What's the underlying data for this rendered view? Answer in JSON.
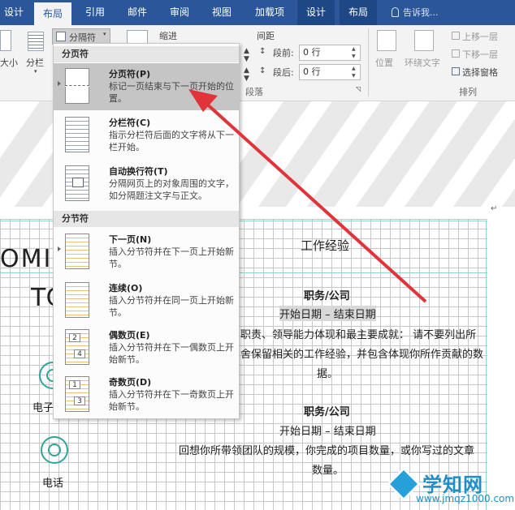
{
  "ribbon_tabs": {
    "design": "设计",
    "layout": "布局",
    "references": "引用",
    "mailings": "邮件",
    "review": "审阅",
    "view": "视图",
    "addins": "加载项",
    "design2": "设计",
    "layout2": "布局"
  },
  "tell_me": "告诉我...",
  "ribbon": {
    "size_label": "大小",
    "columns_label": "分栏",
    "breaks_button": "分隔符",
    "indent_label": "缩进",
    "spacing_label": "间距",
    "before_label": "段前:",
    "before_value": "0 行",
    "after_label": "段后:",
    "after_value": "0 行",
    "paragraph_group": "段落",
    "position_label": "位置",
    "wrap_text_label": "环绕文字",
    "bring_forward": "上移一层",
    "send_backward": "下移一层",
    "selection_pane": "选择窗格",
    "arrange_group": "排列"
  },
  "dropdown": {
    "page_breaks_header": "分页符",
    "section_breaks_header": "分节符",
    "items": [
      {
        "title": "分页符(P)",
        "desc": "标记一页结束与下一页开始的位置。"
      },
      {
        "title": "分栏符(C)",
        "desc": "指示分栏符后面的文字将从下一栏开始。"
      },
      {
        "title": "自动换行符(T)",
        "desc": "分隔网页上的对象周围的文字，如分隔题注文字与正文。"
      },
      {
        "title": "下一页(N)",
        "desc": "插入分节符并在下一页上开始新节。"
      },
      {
        "title": "连续(O)",
        "desc": "插入分节符并在同一页上开始新节。"
      },
      {
        "title": "偶数页(E)",
        "desc": "插入分节符并在下一偶数页上开始新节。"
      },
      {
        "title": "奇数页(D)",
        "desc": "插入分节符并在下一奇数页上开始新节。"
      }
    ],
    "even_numbers": [
      "2",
      "4"
    ],
    "odd_numbers": [
      "1",
      "3"
    ]
  },
  "document": {
    "name_letters_1": "OMIN",
    "name_letters_2": "TC",
    "section_title": "工作经验",
    "job1_title": "职务/公司",
    "job1_dates": "开始日期 – 结束日期",
    "job1_desc_line1": "职责、领导能力体现和最主要成就： 请不要列出所",
    "job1_desc_line2": "舍保留相关的工作经验，并包含体现你所作贡献的数",
    "job1_desc_line3": "据。",
    "job2_title": "职务/公司",
    "job2_dates": "开始日期 – 结束日期",
    "job2_desc_line1": "回想你所带领团队的规模，你完成的项目数量，或你写过的文章",
    "job2_desc_line2": "数量。",
    "email_label": "电子",
    "phone_label": "电话"
  },
  "watermark": {
    "title": "学知网",
    "url": "www.jmqz1000.com"
  },
  "colors": {
    "ribbon_blue": "#2b579a",
    "teal": "#2fa59a",
    "arrow_red": "#e0343a",
    "watermark_blue": "#1c8fc9"
  }
}
